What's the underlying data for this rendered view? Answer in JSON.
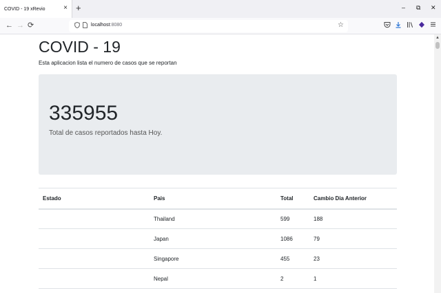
{
  "browser": {
    "tab_title": "COVID - 19 xRevio",
    "tab_close": "×",
    "new_tab": "+",
    "window_controls": {
      "minimize": "–",
      "restore": "⧉",
      "close": "✕"
    },
    "nav": {
      "back": "←",
      "forward": "→",
      "reload": "⟳"
    },
    "url_host": "localhost",
    "url_port": ":8080",
    "toolbar_icons": [
      "shield-icon",
      "page-icon",
      "star-icon",
      "pocket-icon",
      "download-icon",
      "library-icon",
      "extension-icon",
      "menu-icon"
    ]
  },
  "page": {
    "title": "COVID - 19",
    "subtitle": "Esta aplicacion lista el numero de casos que se reportan",
    "total_cases": "335955",
    "total_cases_label": "Total de casos reportados hasta Hoy."
  },
  "table": {
    "headers": [
      "Estado",
      "Pais",
      "Total",
      "Cambio Dia Anterior"
    ],
    "rows": [
      {
        "estado": "",
        "pais": "Thailand",
        "total": "599",
        "cambio": "188"
      },
      {
        "estado": "",
        "pais": "Japan",
        "total": "1086",
        "cambio": "79"
      },
      {
        "estado": "",
        "pais": "Singapore",
        "total": "455",
        "cambio": "23"
      },
      {
        "estado": "",
        "pais": "Nepal",
        "total": "2",
        "cambio": "1"
      }
    ]
  }
}
